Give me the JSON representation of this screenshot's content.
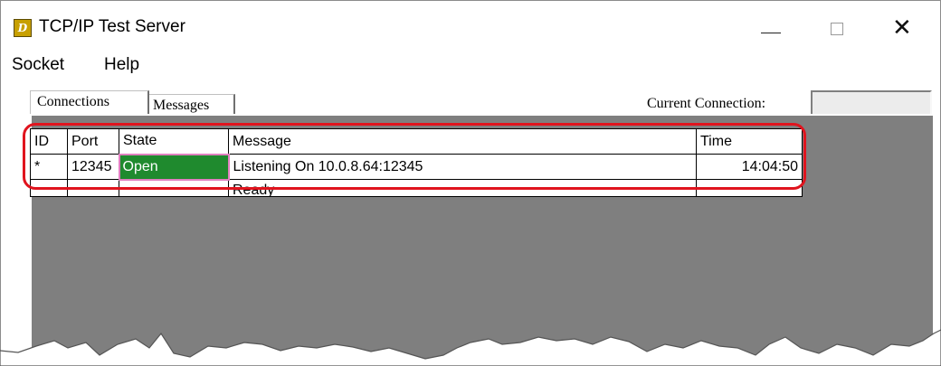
{
  "window": {
    "title": "TCP/IP Test Server",
    "app_icon": "tcp-app-icon",
    "controls": {
      "minimize": "minimize-icon",
      "maximize": "maximize-icon",
      "close": "close-icon"
    }
  },
  "menu": {
    "items": [
      "Socket",
      "Help"
    ]
  },
  "tabs": [
    {
      "label": "Connections",
      "selected": true
    },
    {
      "label": "Messages",
      "selected": false
    }
  ],
  "current_connection": {
    "label": "Current Connection:",
    "value": ""
  },
  "table": {
    "columns": [
      "ID",
      "Port",
      "State",
      "Message",
      "Time"
    ],
    "rows": [
      {
        "id": "*",
        "port": "12345",
        "state": "Open",
        "message": "Listening On 10.0.8.64:12345",
        "time": "14:04:50"
      },
      {
        "id": "",
        "port": "",
        "state": "",
        "message": "Ready",
        "time": ""
      }
    ]
  },
  "colors": {
    "state_open_bg": "#1f8a2e",
    "highlight": "#e0141e",
    "panel_bg": "#7f7f7f"
  }
}
